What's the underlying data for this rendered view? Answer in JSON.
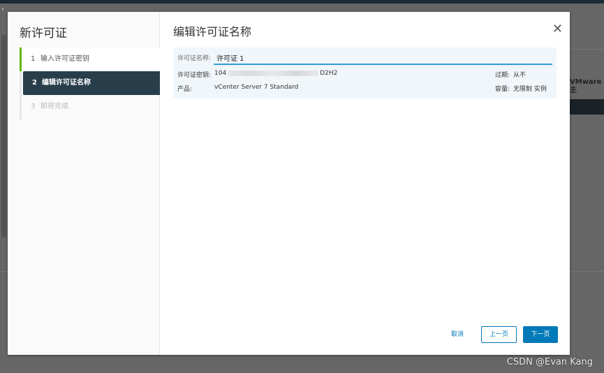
{
  "background": {
    "right_text_1": "VMware",
    "right_text_2": "主"
  },
  "wizard": {
    "title": "新许可证",
    "steps": [
      {
        "number": "1",
        "label": "输入许可证密钥",
        "state": "done"
      },
      {
        "number": "2",
        "label": "编辑许可证名称",
        "state": "active"
      },
      {
        "number": "3",
        "label": "即将完成",
        "state": "todo"
      }
    ]
  },
  "page": {
    "title": "编辑许可证名称",
    "name_label": "许可证名称:",
    "name_value": "许可证 1",
    "key_label": "许可证密钥:",
    "key_start": "104",
    "key_end": "D2H2",
    "product_label": "产品:",
    "product_value": "vCenter Server 7 Standard",
    "expires_label": "过期:",
    "expires_value": "从不",
    "capacity_label": "容量:",
    "capacity_value": "无限制 实例"
  },
  "footer": {
    "cancel": "取消",
    "prev": "上一页",
    "next": "下一页"
  },
  "watermark": "CSDN @Evan Kang",
  "colors": {
    "accent": "#0079b8",
    "active_step": "#283e4b",
    "done_step": "#5fb800"
  }
}
